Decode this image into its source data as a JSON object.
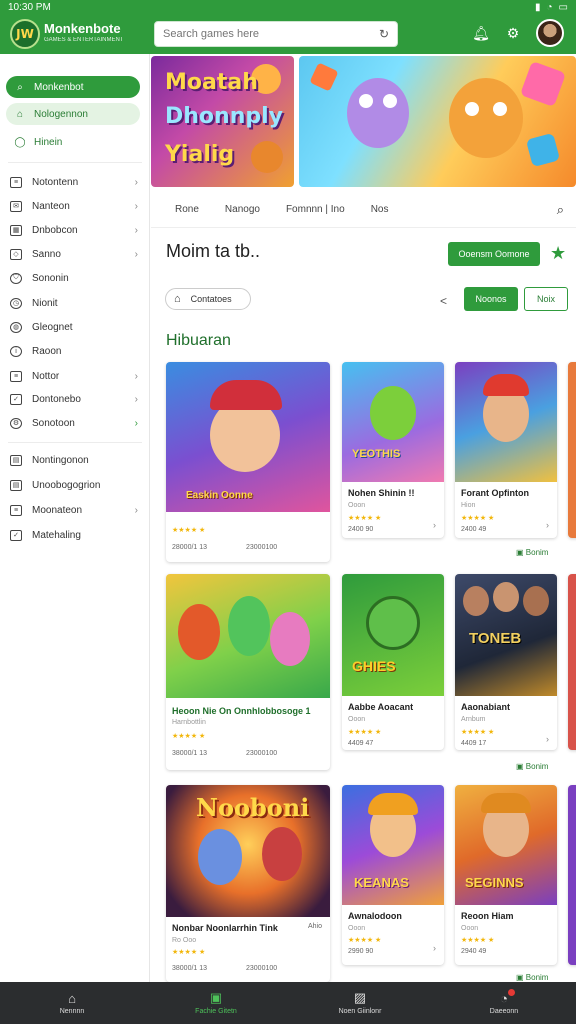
{
  "status": {
    "time": "10:30 PM"
  },
  "app": {
    "title": "Monkenbote",
    "subtitle": "GAMES & ENTERTAINMENT",
    "logo_text": "JW"
  },
  "search": {
    "placeholder": "Search games here",
    "icon": "refresh-icon"
  },
  "sidebar": {
    "primary": [
      {
        "label": "Monkenbot",
        "icon": "search-icon",
        "state": "active"
      },
      {
        "label": "Nologennon",
        "icon": "home-icon",
        "state": "selected"
      },
      {
        "label": "Hinein",
        "icon": "chat-icon",
        "state": "green"
      }
    ],
    "menu": [
      {
        "label": "Notontenn",
        "chevron": true
      },
      {
        "label": "Nanteon",
        "chevron": true
      },
      {
        "label": "Dnbobcon",
        "chevron": true
      },
      {
        "label": "Sanno",
        "chevron": true
      },
      {
        "label": "Sononin",
        "chevron": false
      },
      {
        "label": "Nionit",
        "chevron": false
      },
      {
        "label": "Gleognet",
        "chevron": false
      },
      {
        "label": "Raoon",
        "chevron": false
      },
      {
        "label": "Nottor",
        "chevron": true
      },
      {
        "label": "Dontonebo",
        "chevron": true
      },
      {
        "label": "Sonotoon",
        "chevron": true
      }
    ],
    "menu2": [
      {
        "label": "Nontingonon",
        "chevron": false
      },
      {
        "label": "Unoobogogrion",
        "chevron": false
      },
      {
        "label": "Moonateon",
        "chevron": true
      },
      {
        "label": "Matehaling",
        "chevron": false
      }
    ]
  },
  "banner": {
    "lines": [
      "Moatah",
      "Dhonnply",
      "Yialig"
    ]
  },
  "tabs": [
    "Rone",
    "Nanogo",
    "Fomnnn | Ino",
    "Nos"
  ],
  "page": {
    "title": "Moim ta tb..",
    "primary_button": "Ooensm Oomone"
  },
  "filter": {
    "label": "Contatoes",
    "prev": "<",
    "btn1": "Noonos",
    "btn2": "Noix"
  },
  "category": "Hibuaran",
  "cards": [
    {
      "name": "",
      "art_text": "Easkin Oonne",
      "rating": "★★★★ ★",
      "meta1": "28000/1 13",
      "meta2": "23000100"
    },
    {
      "name": "Nohen Shinin !!",
      "sub": "Ooon",
      "art_text": "YEOTHIS",
      "rating": "★★★★ ★",
      "meta1": "2400 90"
    },
    {
      "name": "Forant Opfinton",
      "sub": "Hion",
      "art_text": "",
      "rating": "★★★★ ★",
      "meta1": "2400 49"
    },
    {
      "name": "Heoon Nie On Onnhlobbosoge 1",
      "sub": "Harnbottlin",
      "art_text": "",
      "rating": "★★★★ ★",
      "meta1": "38000/1 13",
      "meta2": "23000100"
    },
    {
      "name": "Aabbe Aoacant",
      "sub": "Ooon",
      "art_text": "GHIES",
      "rating": "★★★★ ★",
      "meta1": "4409 47"
    },
    {
      "name": "Aaonabiant",
      "sub": "Arnbum",
      "art_text": "TONEB",
      "rating": "★★★★ ★",
      "meta1": "4409 17"
    },
    {
      "name": "Nonbar Noonlarrhin Tink",
      "sub": "Ro Ooo",
      "art_text": "Nooboni",
      "rating": "★★★★ ★",
      "meta1": "38000/1 13",
      "meta2": "23000100",
      "extra": "Ahio"
    },
    {
      "name": "Awnalodoon",
      "sub": "Ooon",
      "art_text": "KEANAS",
      "rating": "★★★★ ★",
      "meta1": "2990 90"
    },
    {
      "name": "Reoon Hiam",
      "sub": "Ooon",
      "art_text": "SEGINNS",
      "rating": "★★★★ ★",
      "meta1": "2940 49"
    }
  ],
  "more_label": "Bonim",
  "bottom_nav": [
    {
      "label": "Nennnn",
      "icon": "home-icon"
    },
    {
      "label": "Fachie Gitetn",
      "icon": "grid-icon",
      "active": true
    },
    {
      "label": "Noen Giinlonr",
      "icon": "image-icon"
    },
    {
      "label": "Daeeonn",
      "icon": "notification-icon"
    }
  ],
  "colors": {
    "primary": "#2f9b3c",
    "accent": "#f2b70d",
    "bottom": "#2b2d2f"
  }
}
